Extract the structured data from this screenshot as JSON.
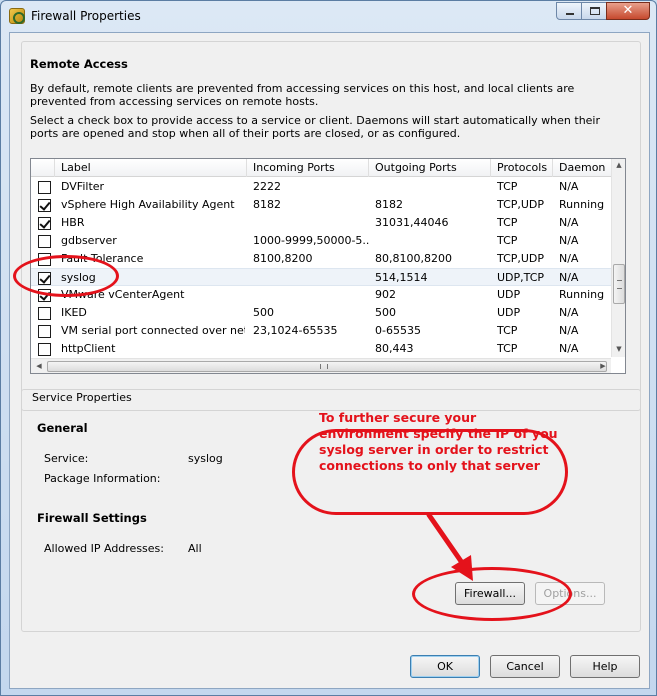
{
  "window": {
    "title": "Firewall Properties"
  },
  "remote_access": {
    "heading": "Remote Access",
    "description_1": "By default, remote clients are prevented from accessing services on this host, and local clients are prevented from accessing services on remote hosts.",
    "description_2": "Select a check box to provide access to a service or client. Daemons will start automatically when their ports are opened and stop when all of their ports are closed, or as configured."
  },
  "table": {
    "columns": [
      "Label",
      "Incoming Ports",
      "Outgoing Ports",
      "Protocols",
      "Daemon"
    ],
    "rows": [
      {
        "checked": false,
        "label": "DVFilter",
        "incoming": "2222",
        "outgoing": "",
        "protocols": "TCP",
        "daemon": "N/A"
      },
      {
        "checked": true,
        "label": "vSphere High Availability Agent",
        "incoming": "8182",
        "outgoing": "8182",
        "protocols": "TCP,UDP",
        "daemon": "Running"
      },
      {
        "checked": true,
        "label": "HBR",
        "incoming": "",
        "outgoing": "31031,44046",
        "protocols": "TCP",
        "daemon": "N/A"
      },
      {
        "checked": false,
        "label": "gdbserver",
        "incoming": "1000-9999,50000-5...",
        "outgoing": "",
        "protocols": "TCP",
        "daemon": "N/A"
      },
      {
        "checked": false,
        "label": "Fault Tolerance",
        "incoming": "8100,8200",
        "outgoing": "80,8100,8200",
        "protocols": "TCP,UDP",
        "daemon": "N/A"
      },
      {
        "checked": true,
        "label": "syslog",
        "incoming": "",
        "outgoing": "514,1514",
        "protocols": "UDP,TCP",
        "daemon": "N/A",
        "selected": true
      },
      {
        "checked": true,
        "label": "VMware vCenterAgent",
        "incoming": "",
        "outgoing": "902",
        "protocols": "UDP",
        "daemon": "Running"
      },
      {
        "checked": false,
        "label": "IKED",
        "incoming": "500",
        "outgoing": "500",
        "protocols": "UDP",
        "daemon": "N/A"
      },
      {
        "checked": false,
        "label": "VM serial port connected over net...",
        "incoming": "23,1024-65535",
        "outgoing": "0-65535",
        "protocols": "TCP",
        "daemon": "N/A"
      },
      {
        "checked": false,
        "label": "httpClient",
        "incoming": "",
        "outgoing": "80,443",
        "protocols": "TCP",
        "daemon": "N/A"
      }
    ]
  },
  "service_properties": {
    "legend": "Service Properties",
    "general_heading": "General",
    "service_label": "Service:",
    "service_value": "syslog",
    "package_label": "Package Information:",
    "package_value": "",
    "firewall_heading": "Firewall Settings",
    "allowed_ip_label": "Allowed IP Addresses:",
    "allowed_ip_value": "All",
    "firewall_button": "Firewall...",
    "options_button": "Options..."
  },
  "footer": {
    "ok": "OK",
    "cancel": "Cancel",
    "help": "Help"
  },
  "annotation": {
    "callout": "To further secure your environment specify the IP of you syslog server in order to restrict connections to only that server",
    "color": "#e4121b"
  }
}
